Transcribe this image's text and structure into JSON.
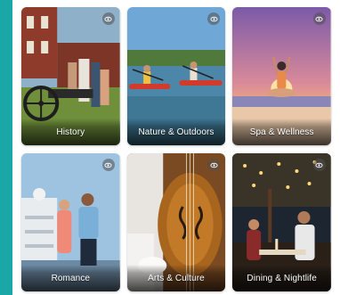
{
  "colors": {
    "frame": "#1aa7a8",
    "panel": "#ffffff",
    "label_text": "#ffffff"
  },
  "categories": [
    {
      "label": "History",
      "icon": "eye-icon"
    },
    {
      "label": "Nature & Outdoors",
      "icon": "eye-icon"
    },
    {
      "label": "Spa & Wellness",
      "icon": "eye-icon"
    },
    {
      "label": "Romance",
      "icon": "eye-icon"
    },
    {
      "label": "Arts & Culture",
      "icon": "eye-icon"
    },
    {
      "label": "Dining & Nightlife",
      "icon": "eye-icon"
    }
  ]
}
